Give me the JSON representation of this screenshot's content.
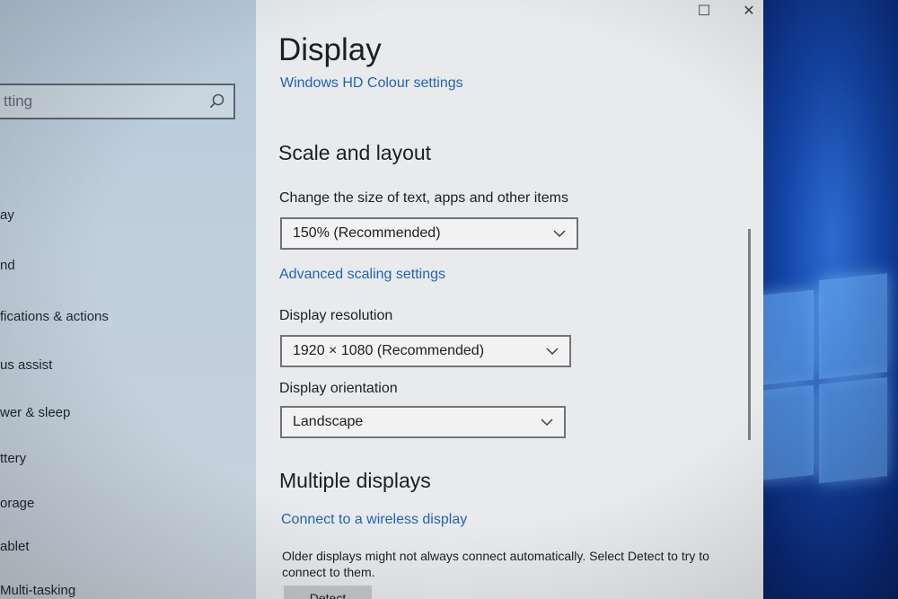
{
  "window": {
    "maximize_icon": "☐",
    "close_icon": "✕"
  },
  "sidebar": {
    "search_placeholder": "tting",
    "items": [
      {
        "label": "ay"
      },
      {
        "label": "nd"
      },
      {
        "label": "fications & actions"
      },
      {
        "label": "us assist"
      },
      {
        "label": "wer & sleep"
      },
      {
        "label": "ttery"
      },
      {
        "label": "orage"
      },
      {
        "label": "ablet"
      },
      {
        "label": "Multi-tasking"
      }
    ]
  },
  "main": {
    "title": "Display",
    "hd_colour_link": "Windows HD Colour settings",
    "scale_section": {
      "heading": "Scale and layout",
      "size_label": "Change the size of text, apps and other items",
      "size_value": "150% (Recommended)",
      "advanced_link": "Advanced scaling settings",
      "resolution_label": "Display resolution",
      "resolution_value": "1920 × 1080 (Recommended)",
      "orientation_label": "Display orientation",
      "orientation_value": "Landscape"
    },
    "multiple_section": {
      "heading": "Multiple displays",
      "wireless_link": "Connect to a wireless display",
      "description": "Older displays might not always connect automatically. Select Detect to try to connect to them.",
      "detect_label": "Detect"
    }
  },
  "colors": {
    "link": "#1f63b8",
    "accent_wallpaper": "#1446a8"
  }
}
